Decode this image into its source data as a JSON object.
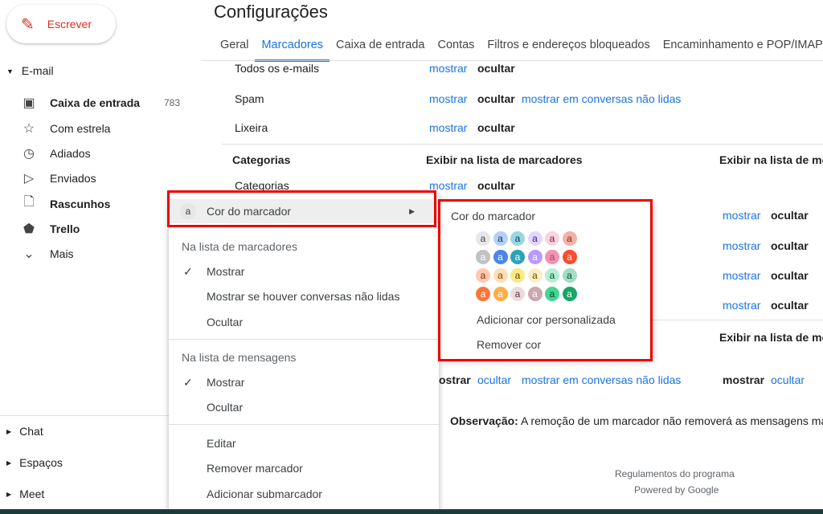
{
  "compose": {
    "label": "Escrever",
    "icon": "pencil-icon"
  },
  "sidebar": {
    "email_header": "E-mail",
    "items": [
      {
        "label": "Caixa de entrada",
        "count": "783",
        "icon": "inbox-icon",
        "bold": true
      },
      {
        "label": "Com estrela",
        "icon": "star-icon"
      },
      {
        "label": "Adiados",
        "icon": "clock-icon"
      },
      {
        "label": "Enviados",
        "icon": "send-icon"
      },
      {
        "label": "Rascunhos",
        "icon": "draft-icon",
        "bold": true
      },
      {
        "label": "Trello",
        "icon": "label-icon",
        "bold": true
      },
      {
        "label": "Mais",
        "icon": "chevron-down-icon"
      }
    ],
    "sections": [
      "Chat",
      "Espaços",
      "Meet"
    ]
  },
  "page_title": "Configurações",
  "tabs": [
    "Geral",
    "Marcadores",
    "Caixa de entrada",
    "Contas",
    "Filtros e endereços bloqueados",
    "Encaminhamento e POP/IMAP"
  ],
  "active_tab": "Marcadores",
  "rows": [
    {
      "name": "Todos os e-mails",
      "show": "mostrar",
      "hide": "ocultar"
    },
    {
      "name": "Spam",
      "show": "mostrar",
      "hide": "ocultar",
      "unread": "mostrar em conversas não lidas"
    },
    {
      "name": "Lixeira",
      "show": "mostrar",
      "hide": "ocultar"
    }
  ],
  "categories": {
    "header": "Categorias",
    "col1": "Exibir na lista de marcadores",
    "col2": "Exibir na lista de mer",
    "row": "Categorias",
    "show": "mostrar",
    "hide": "ocultar"
  },
  "right_rows": {
    "show": "mostrar",
    "hide": "ocultar"
  },
  "labels_header": "Exibir na lista de mer",
  "trello_row": {
    "show_partial": "ostrar",
    "hide": "ocultar",
    "unread": "mostrar em conversas não lidas",
    "show2": "mostrar",
    "hide2": "ocultar"
  },
  "note": {
    "label": "Observação:",
    "text": " A remoção de um marcador não removerá as mensagens ma"
  },
  "footer": {
    "policies": "Regulamentos do programa",
    "powered": "Powered by Google"
  },
  "context_menu": {
    "color_item": "Cor do marcador",
    "color_avatar": "a",
    "section1": "Na lista de marcadores",
    "s1_items": [
      "Mostrar",
      "Mostrar se houver conversas não lidas",
      "Ocultar"
    ],
    "section2": "Na lista de mensagens",
    "s2_items": [
      "Mostrar",
      "Ocultar"
    ],
    "actions": [
      "Editar",
      "Remover marcador",
      "Adicionar submarcador"
    ]
  },
  "color_menu": {
    "title": "Cor do marcador",
    "swatch_letter": "a",
    "swatches": [
      [
        [
          "#e7e7e7",
          "#464646"
        ],
        [
          "#b6cff5",
          "#0d3472"
        ],
        [
          "#98d7e4",
          "#0d3b44"
        ],
        [
          "#e3d7ff",
          "#3d188e"
        ],
        [
          "#fbd3e0",
          "#711a36"
        ],
        [
          "#f2b2a8",
          "#8a1c0a"
        ]
      ],
      [
        [
          "#c2c2c2",
          "#ffffff"
        ],
        [
          "#4986e7",
          "#ffffff"
        ],
        [
          "#2da2bb",
          "#ffffff"
        ],
        [
          "#b99aff",
          "#ffffff"
        ],
        [
          "#f691b2",
          "#994a64"
        ],
        [
          "#fb4c2f",
          "#ffffff"
        ]
      ],
      [
        [
          "#ffc8af",
          "#7a2e0b"
        ],
        [
          "#ffdeb5",
          "#7a4706"
        ],
        [
          "#fbe983",
          "#594c05"
        ],
        [
          "#fdedc1",
          "#684e07"
        ],
        [
          "#b3efd3",
          "#0b4f30"
        ],
        [
          "#a2dcc1",
          "#04502e"
        ]
      ],
      [
        [
          "#ff7537",
          "#ffffff"
        ],
        [
          "#ffad46",
          "#ffffff"
        ],
        [
          "#ebdbde",
          "#662e37"
        ],
        [
          "#cca6ac",
          "#ffffff"
        ],
        [
          "#42d692",
          "#094228"
        ],
        [
          "#16a765",
          "#ffffff"
        ]
      ]
    ],
    "add_custom": "Adicionar cor personalizada",
    "remove": "Remover cor"
  },
  "colors": {
    "accent": "#1a73e8",
    "highlight": "#e00000",
    "compose": "#d93025"
  }
}
